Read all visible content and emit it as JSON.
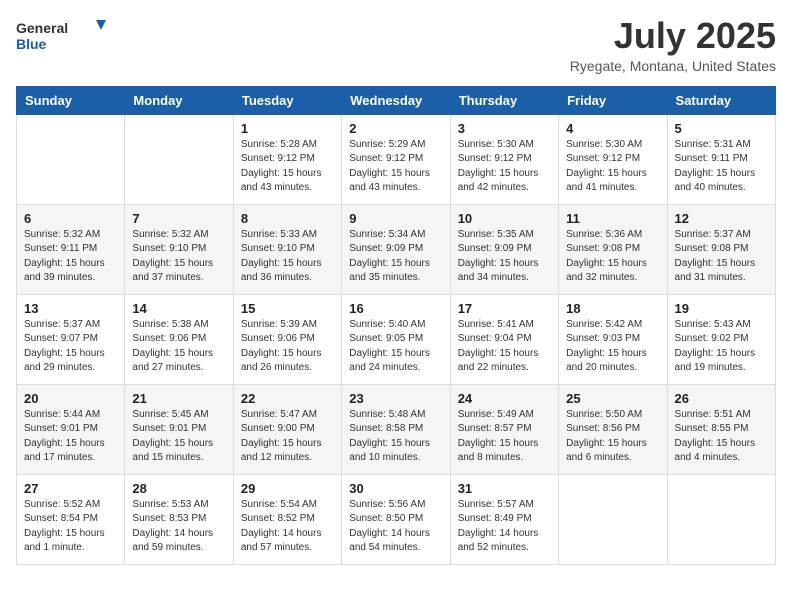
{
  "logo": {
    "general": "General",
    "blue": "Blue"
  },
  "header": {
    "title": "July 2025",
    "subtitle": "Ryegate, Montana, United States"
  },
  "weekdays": [
    "Sunday",
    "Monday",
    "Tuesday",
    "Wednesday",
    "Thursday",
    "Friday",
    "Saturday"
  ],
  "weeks": [
    [
      {
        "day": "",
        "info": ""
      },
      {
        "day": "",
        "info": ""
      },
      {
        "day": "1",
        "info": "Sunrise: 5:28 AM\nSunset: 9:12 PM\nDaylight: 15 hours\nand 43 minutes."
      },
      {
        "day": "2",
        "info": "Sunrise: 5:29 AM\nSunset: 9:12 PM\nDaylight: 15 hours\nand 43 minutes."
      },
      {
        "day": "3",
        "info": "Sunrise: 5:30 AM\nSunset: 9:12 PM\nDaylight: 15 hours\nand 42 minutes."
      },
      {
        "day": "4",
        "info": "Sunrise: 5:30 AM\nSunset: 9:12 PM\nDaylight: 15 hours\nand 41 minutes."
      },
      {
        "day": "5",
        "info": "Sunrise: 5:31 AM\nSunset: 9:11 PM\nDaylight: 15 hours\nand 40 minutes."
      }
    ],
    [
      {
        "day": "6",
        "info": "Sunrise: 5:32 AM\nSunset: 9:11 PM\nDaylight: 15 hours\nand 39 minutes."
      },
      {
        "day": "7",
        "info": "Sunrise: 5:32 AM\nSunset: 9:10 PM\nDaylight: 15 hours\nand 37 minutes."
      },
      {
        "day": "8",
        "info": "Sunrise: 5:33 AM\nSunset: 9:10 PM\nDaylight: 15 hours\nand 36 minutes."
      },
      {
        "day": "9",
        "info": "Sunrise: 5:34 AM\nSunset: 9:09 PM\nDaylight: 15 hours\nand 35 minutes."
      },
      {
        "day": "10",
        "info": "Sunrise: 5:35 AM\nSunset: 9:09 PM\nDaylight: 15 hours\nand 34 minutes."
      },
      {
        "day": "11",
        "info": "Sunrise: 5:36 AM\nSunset: 9:08 PM\nDaylight: 15 hours\nand 32 minutes."
      },
      {
        "day": "12",
        "info": "Sunrise: 5:37 AM\nSunset: 9:08 PM\nDaylight: 15 hours\nand 31 minutes."
      }
    ],
    [
      {
        "day": "13",
        "info": "Sunrise: 5:37 AM\nSunset: 9:07 PM\nDaylight: 15 hours\nand 29 minutes."
      },
      {
        "day": "14",
        "info": "Sunrise: 5:38 AM\nSunset: 9:06 PM\nDaylight: 15 hours\nand 27 minutes."
      },
      {
        "day": "15",
        "info": "Sunrise: 5:39 AM\nSunset: 9:06 PM\nDaylight: 15 hours\nand 26 minutes."
      },
      {
        "day": "16",
        "info": "Sunrise: 5:40 AM\nSunset: 9:05 PM\nDaylight: 15 hours\nand 24 minutes."
      },
      {
        "day": "17",
        "info": "Sunrise: 5:41 AM\nSunset: 9:04 PM\nDaylight: 15 hours\nand 22 minutes."
      },
      {
        "day": "18",
        "info": "Sunrise: 5:42 AM\nSunset: 9:03 PM\nDaylight: 15 hours\nand 20 minutes."
      },
      {
        "day": "19",
        "info": "Sunrise: 5:43 AM\nSunset: 9:02 PM\nDaylight: 15 hours\nand 19 minutes."
      }
    ],
    [
      {
        "day": "20",
        "info": "Sunrise: 5:44 AM\nSunset: 9:01 PM\nDaylight: 15 hours\nand 17 minutes."
      },
      {
        "day": "21",
        "info": "Sunrise: 5:45 AM\nSunset: 9:01 PM\nDaylight: 15 hours\nand 15 minutes."
      },
      {
        "day": "22",
        "info": "Sunrise: 5:47 AM\nSunset: 9:00 PM\nDaylight: 15 hours\nand 12 minutes."
      },
      {
        "day": "23",
        "info": "Sunrise: 5:48 AM\nSunset: 8:58 PM\nDaylight: 15 hours\nand 10 minutes."
      },
      {
        "day": "24",
        "info": "Sunrise: 5:49 AM\nSunset: 8:57 PM\nDaylight: 15 hours\nand 8 minutes."
      },
      {
        "day": "25",
        "info": "Sunrise: 5:50 AM\nSunset: 8:56 PM\nDaylight: 15 hours\nand 6 minutes."
      },
      {
        "day": "26",
        "info": "Sunrise: 5:51 AM\nSunset: 8:55 PM\nDaylight: 15 hours\nand 4 minutes."
      }
    ],
    [
      {
        "day": "27",
        "info": "Sunrise: 5:52 AM\nSunset: 8:54 PM\nDaylight: 15 hours\nand 1 minute."
      },
      {
        "day": "28",
        "info": "Sunrise: 5:53 AM\nSunset: 8:53 PM\nDaylight: 14 hours\nand 59 minutes."
      },
      {
        "day": "29",
        "info": "Sunrise: 5:54 AM\nSunset: 8:52 PM\nDaylight: 14 hours\nand 57 minutes."
      },
      {
        "day": "30",
        "info": "Sunrise: 5:56 AM\nSunset: 8:50 PM\nDaylight: 14 hours\nand 54 minutes."
      },
      {
        "day": "31",
        "info": "Sunrise: 5:57 AM\nSunset: 8:49 PM\nDaylight: 14 hours\nand 52 minutes."
      },
      {
        "day": "",
        "info": ""
      },
      {
        "day": "",
        "info": ""
      }
    ]
  ]
}
